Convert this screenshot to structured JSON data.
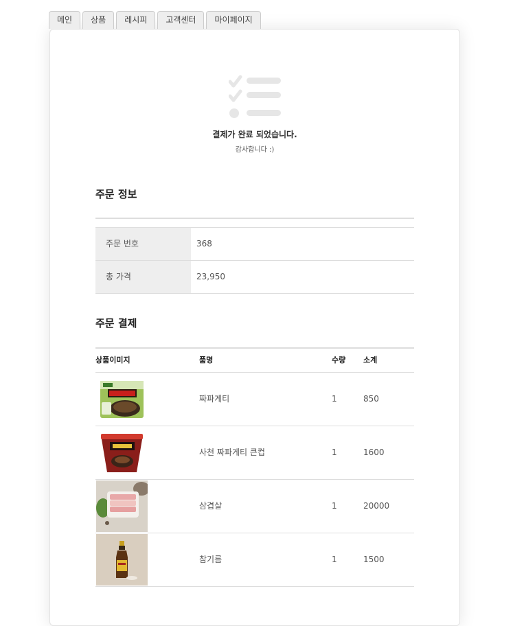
{
  "tabs": [
    "메인",
    "상품",
    "레시피",
    "고객센터",
    "마이페이지"
  ],
  "complete": {
    "title": "결제가 완료 되었습니다.",
    "subtitle": "감사합니다 :)"
  },
  "order_info": {
    "title": "주문 정보",
    "rows": [
      {
        "label": "주문 번호",
        "value": "368"
      },
      {
        "label": "총 가격",
        "value": "23,950"
      }
    ]
  },
  "order_payment": {
    "title": "주문 결제",
    "columns": {
      "image": "상품이미지",
      "name": "품명",
      "qty": "수량",
      "subtotal": "소계"
    },
    "items": [
      {
        "name": "짜파게티",
        "qty": "1",
        "subtotal": "850",
        "image": "chapagetti-pack-image"
      },
      {
        "name": "사천 짜파게티 큰컵",
        "qty": "1",
        "subtotal": "1600",
        "image": "chapagetti-cup-image"
      },
      {
        "name": "삼겹살",
        "qty": "1",
        "subtotal": "20000",
        "image": "pork-belly-image"
      },
      {
        "name": "참기름",
        "qty": "1",
        "subtotal": "1500",
        "image": "sesame-oil-image"
      }
    ]
  },
  "colors": {
    "tab_bg": "#eeeeee",
    "label_bg": "#eeeeee",
    "border": "#dddddd",
    "icon": "#e6e6e6"
  }
}
